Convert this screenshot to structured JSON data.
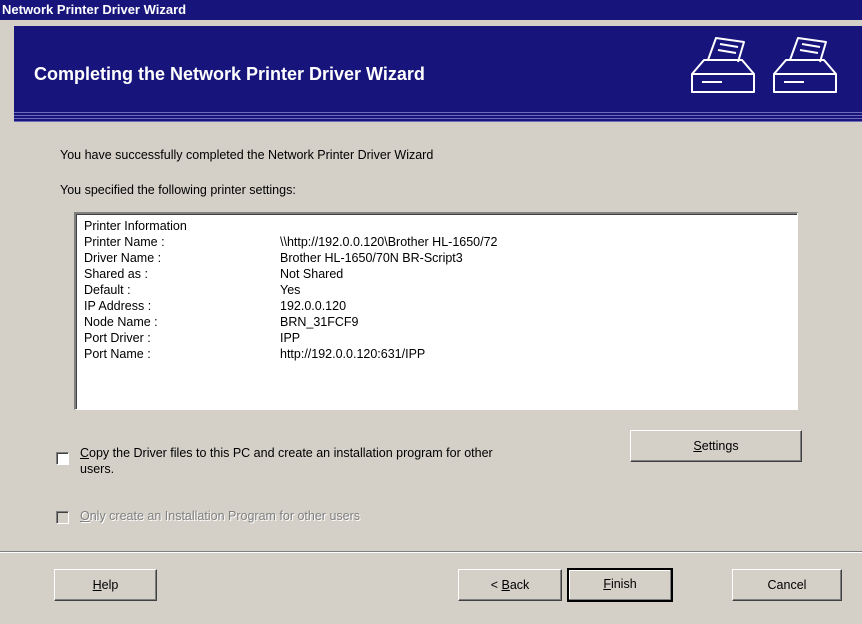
{
  "window": {
    "title": "Network Printer Driver Wizard"
  },
  "banner": {
    "title": "Completing the Network Printer Driver Wizard",
    "icons": [
      "printer-icon",
      "printer-icon"
    ]
  },
  "main": {
    "completed_text": "You have successfully completed the Network Printer Driver Wizard",
    "specified_text": "You specified the following printer settings:"
  },
  "printer_info": {
    "header": "Printer Information",
    "rows": [
      {
        "key": "Printer Name :",
        "value": "\\\\http://192.0.0.120\\Brother HL-1650/72"
      },
      {
        "key": "Driver Name :",
        "value": "Brother HL-1650/70N BR-Script3"
      },
      {
        "key": "Shared as :",
        "value": "Not Shared"
      },
      {
        "key": "Default :",
        "value": "Yes"
      },
      {
        "key": "IP Address :",
        "value": "192.0.0.120"
      },
      {
        "key": "Node Name :",
        "value": "BRN_31FCF9"
      },
      {
        "key": "Port Driver :",
        "value": "IPP"
      },
      {
        "key": "Port Name :",
        "value": "http://192.0.0.120:631/IPP"
      }
    ]
  },
  "options": {
    "copy_checkbox": {
      "checked": false,
      "mnemonic": "C",
      "label_rest": "opy the Driver files to this PC and create an installation program for other",
      "label_line2": "users."
    },
    "settings_button": {
      "mnemonic": "S",
      "label_rest": "ettings"
    },
    "only_create_checkbox": {
      "checked": false,
      "enabled": false,
      "mnemonic": "O",
      "label_rest": "nly create an Installation Program for other users"
    }
  },
  "buttons": {
    "help": {
      "mnemonic": "H",
      "label_rest": "elp"
    },
    "back": {
      "prefix": "< ",
      "mnemonic": "B",
      "label_rest": "ack"
    },
    "finish": {
      "mnemonic": "F",
      "label_rest": "inish"
    },
    "cancel": {
      "label": "Cancel"
    }
  },
  "colors": {
    "titlebar": "#17157c",
    "dialog": "#d4d0c8"
  }
}
